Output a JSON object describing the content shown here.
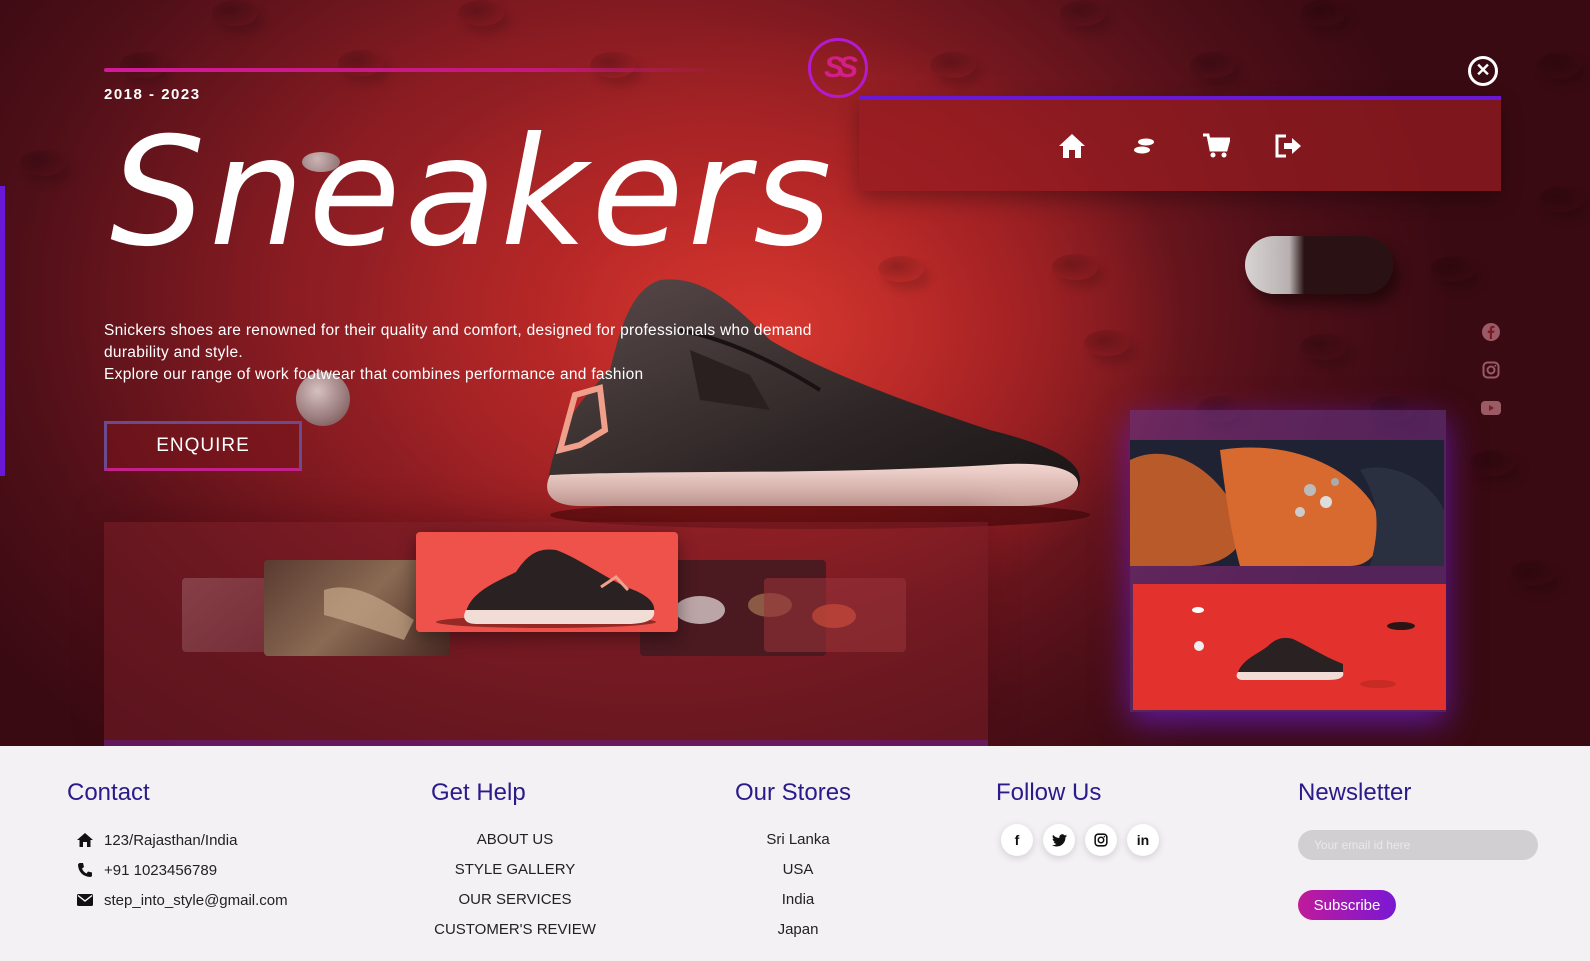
{
  "hero": {
    "years": "2018  -  2023",
    "logo_text": "SS",
    "title": "Sneakers",
    "description_line1": "Snickers shoes are renowned for their quality and comfort, designed for professionals who demand durability and style.",
    "description_line2": "Explore our range of work footwear that combines performance and fashion",
    "enquire_label": "ENQUIRE",
    "close_symbol": "✕"
  },
  "nav": {
    "items": [
      {
        "icon": "home-icon"
      },
      {
        "icon": "shoe-prints-icon"
      },
      {
        "icon": "cart-icon"
      },
      {
        "icon": "logout-icon"
      }
    ]
  },
  "side_social": [
    {
      "icon": "facebook-icon"
    },
    {
      "icon": "instagram-icon"
    },
    {
      "icon": "youtube-icon"
    }
  ],
  "colors": {
    "accent_purple": "#6a18d8",
    "accent_pink": "#d21a9a",
    "heading_blue": "#2a1a8a",
    "hero_red": "#b72a2a"
  },
  "footer": {
    "contact": {
      "heading": "Contact",
      "address": "123/Rajasthan/India",
      "phone": "+91 1023456789",
      "email": "step_into_style@gmail.com"
    },
    "help": {
      "heading": "Get Help",
      "links": [
        "ABOUT US",
        "STYLE GALLERY",
        "OUR SERVICES",
        "CUSTOMER'S REVIEW"
      ]
    },
    "stores": {
      "heading": "Our Stores",
      "items": [
        "Sri Lanka",
        "USA",
        "India",
        "Japan"
      ]
    },
    "follow": {
      "heading": "Follow Us",
      "items": [
        {
          "icon": "facebook-icon",
          "glyph": "f"
        },
        {
          "icon": "twitter-icon",
          "glyph": ""
        },
        {
          "icon": "instagram-icon",
          "glyph": ""
        },
        {
          "icon": "linkedin-icon",
          "glyph": "in"
        }
      ]
    },
    "newsletter": {
      "heading": "Newsletter",
      "placeholder": "Your email id here",
      "button_label": "Subscribe"
    }
  }
}
